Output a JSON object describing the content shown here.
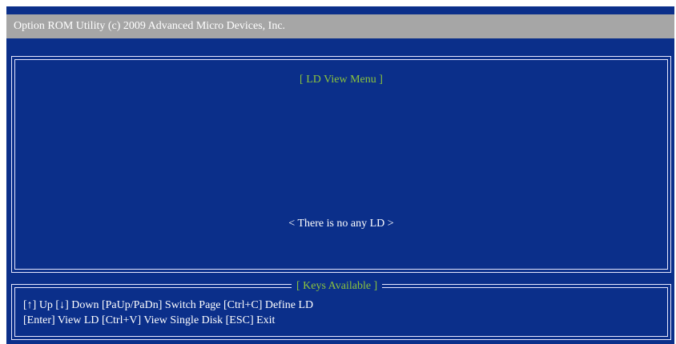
{
  "title_bar": {
    "text": "Option ROM Utility (c) 2009 Advanced Micro Devices, Inc."
  },
  "ld_view": {
    "title": "[ LD  View Menu ]",
    "message": "< There is no any LD >"
  },
  "keys_available": {
    "title": "[ Keys Available ]",
    "line1": "[↑] Up   [↓] Down   [PaUp/PaDn] Switch Page   [Ctrl+C] Define LD",
    "line2": "[Enter] View LD   [Ctrl+V] View Single Disk   [ESC] Exit"
  },
  "colors": {
    "background": "#0b2f8a",
    "title_bar": "#a6a6a6",
    "accent_green": "#8cc43c",
    "text": "#ffffff"
  }
}
